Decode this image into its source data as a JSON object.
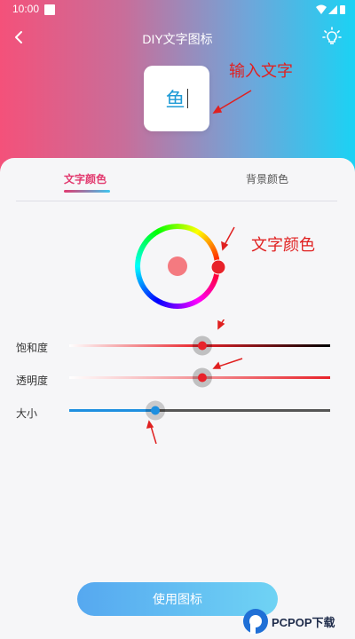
{
  "status_bar": {
    "time": "10:00"
  },
  "header": {
    "title": "DIY文字图标"
  },
  "preview": {
    "text": "鱼"
  },
  "annotations": {
    "input_text": "输入文字",
    "text_color": "文字颜色"
  },
  "tabs": [
    {
      "label": "文字颜色",
      "selected": true
    },
    {
      "label": "背景颜色",
      "selected": false
    }
  ],
  "color": {
    "selected": "#f47a80",
    "accent": "#e8222a"
  },
  "sliders": [
    {
      "label": "饱和度",
      "value": 0.51
    },
    {
      "label": "透明度",
      "value": 0.51
    },
    {
      "label": "大小",
      "value": 0.33
    }
  ],
  "footer": {
    "use_button": "使用图标"
  },
  "watermark": {
    "text": "PCPOP下载"
  }
}
